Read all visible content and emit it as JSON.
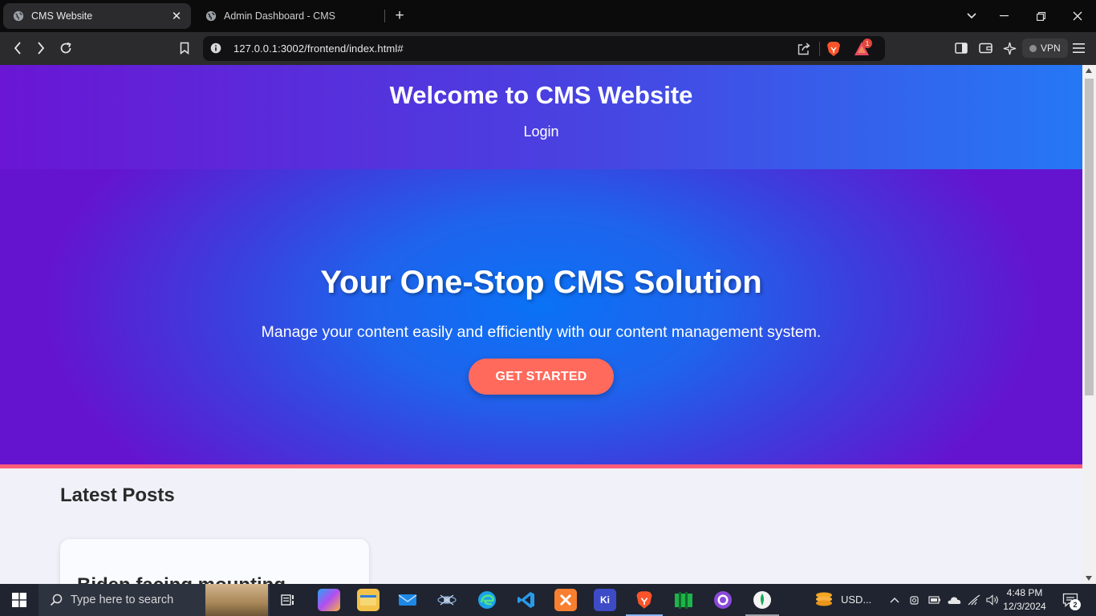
{
  "browser": {
    "tabs": [
      {
        "title": "CMS Website",
        "active": true
      },
      {
        "title": "Admin Dashboard - CMS",
        "active": false
      }
    ],
    "new_tab_symbol": "+",
    "close_symbol": "✕",
    "url": "127.0.0.1:3002/frontend/index.html#",
    "rewards_badge": "1",
    "vpn_label": "VPN",
    "icons": [
      "globe-icon",
      "back-icon",
      "forward-icon",
      "reload-icon",
      "bookmark-icon",
      "info-icon",
      "share-icon",
      "brave-lion-icon",
      "rewards-icon",
      "sidebar-icon",
      "wallet-icon",
      "leo-icon",
      "menu-icon"
    ]
  },
  "page": {
    "header": {
      "title": "Welcome to CMS Website",
      "login_link": "Login"
    },
    "hero": {
      "title": "Your One-Stop CMS Solution",
      "subtitle": "Manage your content easily and efficiently with our content management system.",
      "cta": "GET STARTED"
    },
    "posts": {
      "heading": "Latest Posts",
      "items": [
        {
          "title": "Biden facing mounting"
        }
      ]
    },
    "colors": {
      "header_gradient_start": "#6a16d4",
      "header_gradient_end": "#2578f5",
      "hero_center": "#0a72f6",
      "hero_edge": "#6414cf",
      "cta_bg": "#ff6a5c",
      "accent_bar": "#ff5c7a",
      "page_bg": "#f0f1f9"
    }
  },
  "taskbar": {
    "search_placeholder": "Type here to search",
    "weather_text": "USD...",
    "time": "4:48 PM",
    "date": "12/3/2024",
    "notification_count": "2",
    "pinned_apps": [
      "copilot",
      "file-explorer",
      "mail",
      "network-app",
      "edge",
      "vscode",
      "xampp",
      "kite",
      "brave",
      "terminal-app",
      "github-desktop",
      "mongodb-compass"
    ]
  }
}
